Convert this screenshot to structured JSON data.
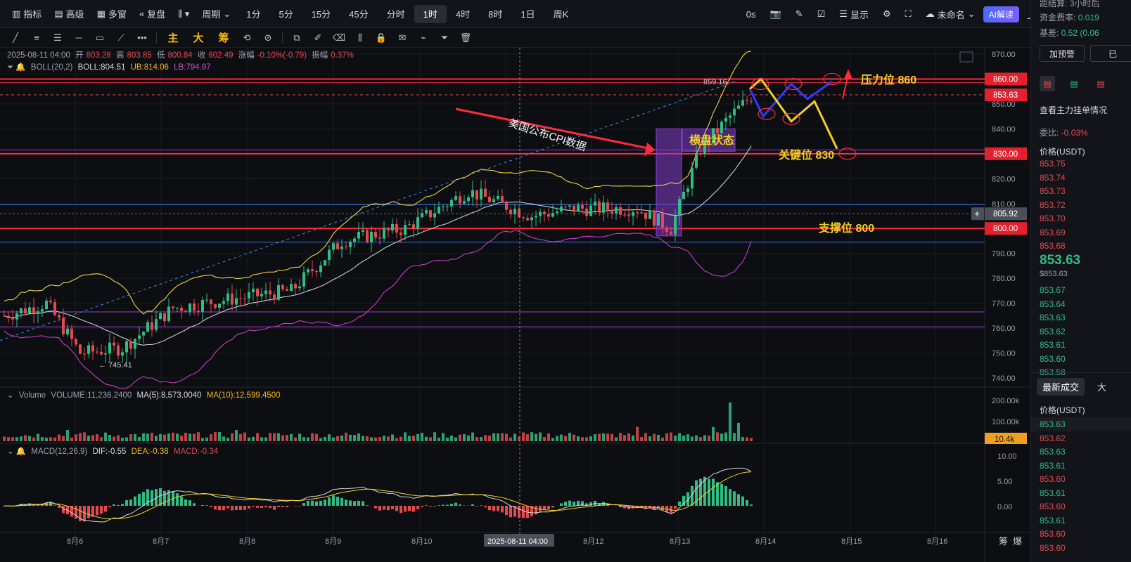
{
  "toolbar": {
    "items": [
      "指标",
      "高级",
      "多窗",
      "复盘"
    ],
    "period_label": "周期",
    "intervals": [
      "1分",
      "5分",
      "15分",
      "45分",
      "分时",
      "1时",
      "4时",
      "8时",
      "1日",
      "周K"
    ],
    "active_interval": "1时",
    "right": {
      "countdown": "0s",
      "display": "显示",
      "layout_name": "未命名",
      "ai": "AI解读"
    }
  },
  "drawbar": {
    "cn_tools": [
      "主",
      "大",
      "筹"
    ]
  },
  "ohlc": {
    "datetime": "2025-08-11 04:00",
    "open_label": "开",
    "open": "803.28",
    "high_label": "高",
    "high": "803.85",
    "low_label": "低",
    "low": "800.84",
    "close_label": "收",
    "close": "802.49",
    "change_label": "涨幅",
    "change": "-0.10%(-0.79)",
    "amp_label": "振幅",
    "amp": "0.37%"
  },
  "boll": {
    "name": "BOLL(20,2)",
    "boll": "BOLL:804.51",
    "ub": "UB:814.06",
    "lb": "LB:794.97"
  },
  "volume_info": {
    "name": "Volume",
    "vol": "VOLUME:11,236.2400",
    "ma5": "MA(5):8,573.0040",
    "ma10": "MA(10):12,599.4500"
  },
  "macd_info": {
    "name": "MACD(12,26,9)",
    "dif": "DIF:-0.55",
    "dea": "DEA:-0.38",
    "macd": "MACD:-0.34"
  },
  "annotations": {
    "cpi": "美国公布CPI数据",
    "consolidation": "横盘状态",
    "resistance": "压力位 860",
    "key_level": "关键位 830",
    "support": "支撑位 800",
    "high_mark": "859.16",
    "low_mark": "← 745.41"
  },
  "price_axis": [
    "870.00",
    "860.00",
    "850.00",
    "840.00",
    "830.00",
    "820.00",
    "810.00",
    "800.00",
    "790.00",
    "780.00",
    "770.00",
    "760.00",
    "750.00",
    "740.00"
  ],
  "price_tags": {
    "resistance": "860.00",
    "current": "853.63",
    "key": "830.00",
    "cursor": "805.92",
    "support": "800.00"
  },
  "volume_axis": [
    "200.00k",
    "100.00k"
  ],
  "volume_tag": "10.4k",
  "macd_axis": [
    "10.00",
    "5.00",
    "0.00"
  ],
  "time_axis": [
    "8月6",
    "8月7",
    "8月8",
    "8月9",
    "8月10",
    "8月12",
    "8月13",
    "8月14",
    "8月15",
    "8月16"
  ],
  "cursor_time": "2025-08-11 04:00",
  "bottom_right": [
    "筹",
    "爆"
  ],
  "right_panel": {
    "settle_label": "距结算:",
    "settle_value": "3小时后",
    "funding_label": "资金费率:",
    "funding_value": "0.019",
    "basis_label": "基差:",
    "basis_value": "0.52 (0.06",
    "alert_btn": "加预警",
    "order_view": "查看主力挂单情况",
    "ratio_label": "委比:",
    "ratio_value": "-0.03%",
    "price_header": "价格(USDT)",
    "asks": [
      "853.75",
      "853.74",
      "853.73",
      "853.72",
      "853.70",
      "853.69",
      "853.68"
    ],
    "last_price": "853.63",
    "last_price_sub": "$853.63",
    "bids": [
      "853.67",
      "853.64",
      "853.63",
      "853.62",
      "853.61",
      "853.60",
      "853.58"
    ],
    "trades_tab": "最新成交",
    "trades_tab2": "大",
    "trades_header": "价格(USDT)",
    "trades": [
      {
        "p": "853.63",
        "s": "buy"
      },
      {
        "p": "853.62",
        "s": "sell"
      },
      {
        "p": "853.63",
        "s": "buy"
      },
      {
        "p": "853.61",
        "s": "buy"
      },
      {
        "p": "853.60",
        "s": "sell"
      },
      {
        "p": "853.61",
        "s": "buy"
      },
      {
        "p": "853.60",
        "s": "sell"
      },
      {
        "p": "853.61",
        "s": "buy"
      },
      {
        "p": "853.60",
        "s": "sell"
      },
      {
        "p": "853.60",
        "s": "sell"
      }
    ]
  },
  "colors": {
    "up": "#2ebd85",
    "down": "#e24a4f",
    "accent": "#f0b90b",
    "bg": "#0d0e12"
  }
}
